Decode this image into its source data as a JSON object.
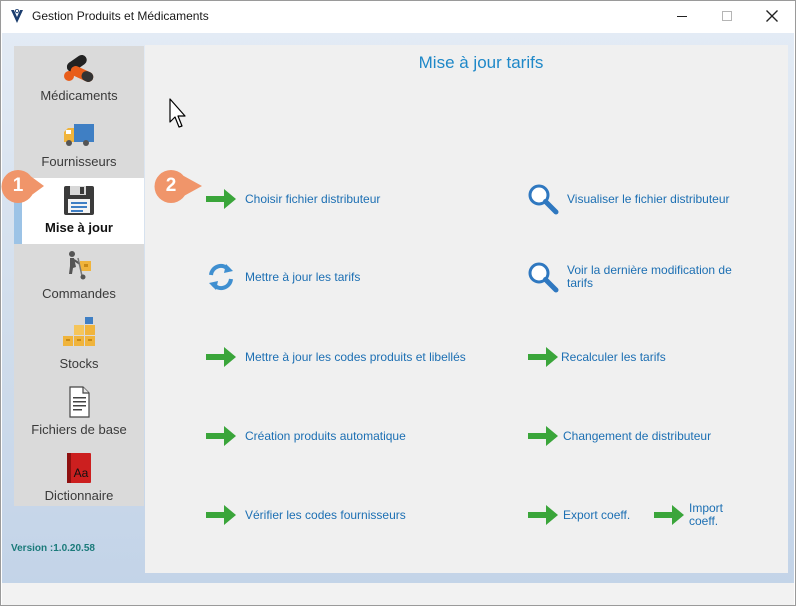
{
  "window": {
    "title": "Gestion Produits et Médicaments",
    "minimize_icon": "minimize-icon",
    "maximize_icon": "maximize-icon",
    "close_icon": "close-icon"
  },
  "sidebar": {
    "items": [
      {
        "label": "Médicaments",
        "icon": "pills-icon"
      },
      {
        "label": "Fournisseurs",
        "icon": "truck-icon"
      },
      {
        "label": "Mise à jour",
        "icon": "floppy-disk-icon",
        "active": true
      },
      {
        "label": "Commandes",
        "icon": "hand-truck-icon"
      },
      {
        "label": "Stocks",
        "icon": "boxes-icon"
      },
      {
        "label": "Fichiers de base",
        "icon": "document-icon"
      },
      {
        "label": "Dictionnaire",
        "icon": "dictionary-icon"
      }
    ],
    "version": "Version :1.0.20.58"
  },
  "main": {
    "title": "Mise à jour tarifs",
    "left_actions": [
      {
        "label": "Choisir fichier distributeur",
        "icon": "green-arrow-icon"
      },
      {
        "label": "Mettre à jour les tarifs",
        "icon": "refresh-icon"
      },
      {
        "label": "Mettre à jour les codes produits et libellés",
        "icon": "green-arrow-icon"
      },
      {
        "label": "Création produits automatique",
        "icon": "green-arrow-icon"
      },
      {
        "label": "Vérifier les codes fournisseurs",
        "icon": "green-arrow-icon"
      }
    ],
    "right_actions": [
      {
        "label": "Visualiser le fichier distributeur",
        "icon": "magnifier-icon"
      },
      {
        "label": "Voir la dernière modification de tarifs",
        "icon": "magnifier-icon"
      },
      {
        "label": "Recalculer les tarifs",
        "icon": "green-arrow-icon"
      },
      {
        "label": "Changement de distributeur",
        "icon": "green-arrow-icon"
      },
      {
        "label": "Export coeff.",
        "icon": "green-arrow-icon"
      },
      {
        "label": "Import coeff.",
        "icon": "green-arrow-icon"
      }
    ]
  },
  "callouts": [
    "1",
    "2"
  ],
  "colors": {
    "accent": "#1e88c8",
    "link": "#1c6fb3",
    "arrow_green": "#3aa53a",
    "callout_orange": "#f0956a",
    "version_teal": "#1a7a7a"
  }
}
